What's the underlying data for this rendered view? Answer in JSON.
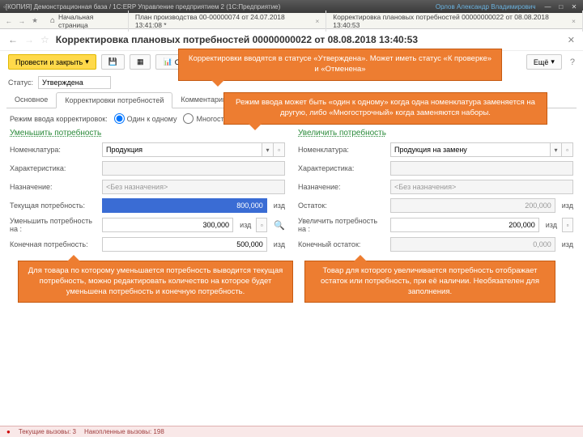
{
  "titlebar": {
    "title": "[КОПИЯ] Демонстрационная база / 1C:ERP Управление предприятием 2 (1С:Предприятие)",
    "user": "Орлов Александр Владимирович"
  },
  "tabs": {
    "home": "Начальная страница",
    "t1": "План производства 00-00000074 от 24.07.2018 13:41:08 *",
    "t2": "Корректировка плановых потребностей 00000000022 от 08.08.2018 13:40:53"
  },
  "header": {
    "title": "Корректировка плановых потребностей 00000000022 от 08.08.2018 13:40:53"
  },
  "toolbar": {
    "commit": "Провести и закрыть",
    "reports": "Отчёты",
    "more": "Ещё"
  },
  "status": {
    "label": "Статус:",
    "value": "Утверждена"
  },
  "doctabs": {
    "main": "Основное",
    "corr": "Корректировки потребностей",
    "comm": "Комментарий"
  },
  "mode": {
    "label": "Режим ввода корректировок:",
    "one": "Один к одному",
    "multi": "Многострочный"
  },
  "left": {
    "heading": "Уменьшить потребность",
    "nomen_l": "Номенклатура:",
    "nomen_v": "Продукция",
    "char_l": "Характеристика:",
    "char_v": "",
    "nazn_l": "Назначение:",
    "nazn_v": "<Без назначения>",
    "curr_l": "Текущая потребность:",
    "curr_v": "800,000",
    "dec_l": "Уменьшить потребность на :",
    "dec_v": "300,000",
    "fin_l": "Конечная потребность:",
    "fin_v": "500,000",
    "unit": "изд"
  },
  "right": {
    "heading": "Увеличить потребность",
    "nomen_l": "Номенклатура:",
    "nomen_v": "Продукция на замену",
    "char_l": "Характеристика:",
    "char_v": "",
    "nazn_l": "Назначение:",
    "nazn_v": "<Без назначения>",
    "rest_l": "Остаток:",
    "rest_v": "200,000",
    "inc_l": "Увеличить потребность на :",
    "inc_v": "200,000",
    "fin_l": "Конечный остаток:",
    "fin_v": "0,000",
    "unit": "изд"
  },
  "callouts": {
    "c1": "Корректировки вводятся в статусе «Утверждена». Может иметь статус «К проверке» и «Отменена»",
    "c2": "Режим ввода может быть «один к одному» когда одна номенклатура заменяется на другую, либо «Многострочный» когда заменяются наборы.",
    "c3": "Для товара по которому уменьшается потребность выводится текущая потребность, можно редактировать количество на которое будет уменьшена потребность и конечную потребность.",
    "c4": "Товар для которого увеличивается потребность отображает остаток или потребность, при её наличии. Необязателен для заполнения."
  },
  "footer": {
    "curr": "Текущие вызовы: 3",
    "acc": "Накопленные вызовы: 198"
  }
}
